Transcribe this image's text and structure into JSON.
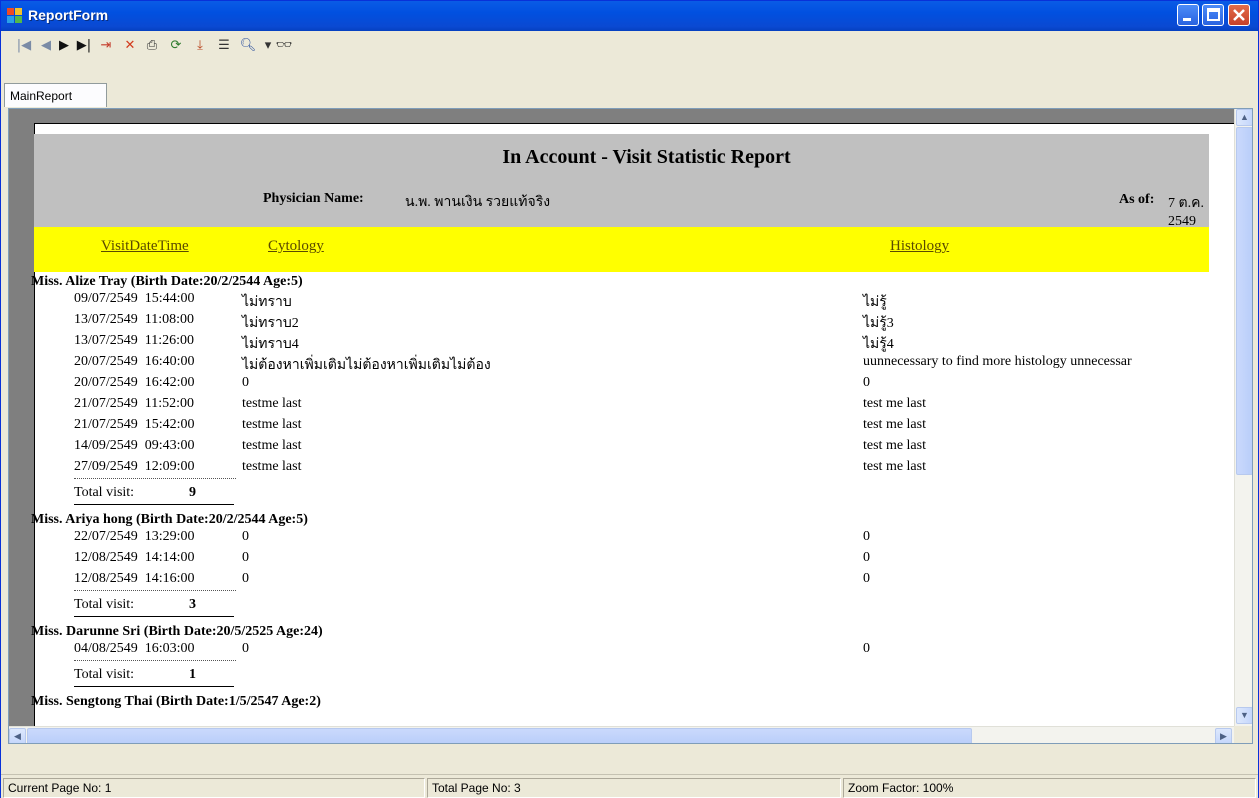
{
  "window": {
    "title": "ReportForm",
    "controls": [
      "minimize-icon",
      "maximize-icon",
      "close-icon"
    ]
  },
  "toolbar": {
    "buttons": [
      {
        "icon": "first-page-icon",
        "glyph": "|◀"
      },
      {
        "icon": "previous-page-icon",
        "glyph": "◀"
      },
      {
        "icon": "next-page-icon",
        "glyph": "▶"
      },
      {
        "icon": "last-page-icon",
        "glyph": "▶|"
      },
      {
        "icon": "goto-page-icon",
        "glyph": "⇥"
      },
      {
        "icon": "close-report-icon",
        "glyph": "✕"
      },
      {
        "icon": "print-icon",
        "glyph": "⎙"
      },
      {
        "icon": "refresh-icon",
        "glyph": "⟳"
      },
      {
        "icon": "export-icon",
        "glyph": "⤓"
      },
      {
        "icon": "group-tree-icon",
        "glyph": "☰"
      },
      {
        "icon": "zoom-icon",
        "glyph": "🔍︎"
      },
      {
        "icon": "zoom-dropdown-icon",
        "glyph": "▾"
      },
      {
        "icon": "search-text-icon",
        "glyph": "👓︎"
      }
    ]
  },
  "tabs": [
    {
      "label": "MainReport"
    }
  ],
  "report": {
    "title": "In Account - Visit Statistic Report",
    "physician_label": "Physician Name:",
    "physician_name": "น.พ. พานเงิน รวยแท้จริง",
    "asof_label": "As of:",
    "asof_value": "7 ต.ค. 2549",
    "columns": {
      "visit": "VisitDateTime",
      "cytology": "Cytology",
      "histology": "Histology"
    },
    "groups": [
      {
        "header": "Miss. Alize Tray (Birth Date:20/2/2544 Age:5)",
        "total_label": "Total visit:",
        "total": "9",
        "rows": [
          {
            "dt": "09/07/2549  15:44:00",
            "cy": "ไม่ทราบ",
            "hi": "ไม่รู้"
          },
          {
            "dt": "13/07/2549  11:08:00",
            "cy": "ไม่ทราบ2",
            "hi": "ไม่รู้3"
          },
          {
            "dt": "13/07/2549  11:26:00",
            "cy": "ไม่ทราบ4",
            "hi": "ไม่รู้4"
          },
          {
            "dt": "20/07/2549  16:40:00",
            "cy": "ไม่ต้องหาเพิ่มเติมไม่ต้องหาเพิ่มเติมไม่ต้อง",
            "hi": "uunnecessary to find more histology unnecessar"
          },
          {
            "dt": "20/07/2549  16:42:00",
            "cy": "0",
            "hi": "0"
          },
          {
            "dt": "21/07/2549  11:52:00",
            "cy": "testme last",
            "hi": "test me last"
          },
          {
            "dt": "21/07/2549  15:42:00",
            "cy": "testme last",
            "hi": "test me last"
          },
          {
            "dt": "14/09/2549  09:43:00",
            "cy": "testme last",
            "hi": "test me last"
          },
          {
            "dt": "27/09/2549  12:09:00",
            "cy": "testme last",
            "hi": "test me last"
          }
        ]
      },
      {
        "header": "Miss. Ariya hong (Birth Date:20/2/2544 Age:5)",
        "total_label": "Total visit:",
        "total": "3",
        "rows": [
          {
            "dt": "22/07/2549  13:29:00",
            "cy": "0",
            "hi": "0"
          },
          {
            "dt": "12/08/2549  14:14:00",
            "cy": "0",
            "hi": "0"
          },
          {
            "dt": "12/08/2549  14:16:00",
            "cy": "0",
            "hi": "0"
          }
        ]
      },
      {
        "header": "Miss. Darunne Sri (Birth Date:20/5/2525 Age:24)",
        "total_label": "Total visit:",
        "total": "1",
        "rows": [
          {
            "dt": "04/08/2549  16:03:00",
            "cy": "0",
            "hi": "0"
          }
        ]
      },
      {
        "header": "Miss. Sengtong Thai (Birth Date:1/5/2547 Age:2)",
        "rows": []
      }
    ]
  },
  "statusbar": {
    "current_page": "Current Page No: 1",
    "total_pages": "Total Page No: 3",
    "zoom": "Zoom Factor: 100%"
  },
  "colors": {
    "header_band": "#c0c0c0",
    "column_band": "#ffff00",
    "title_bar": "#0a5ce6"
  }
}
